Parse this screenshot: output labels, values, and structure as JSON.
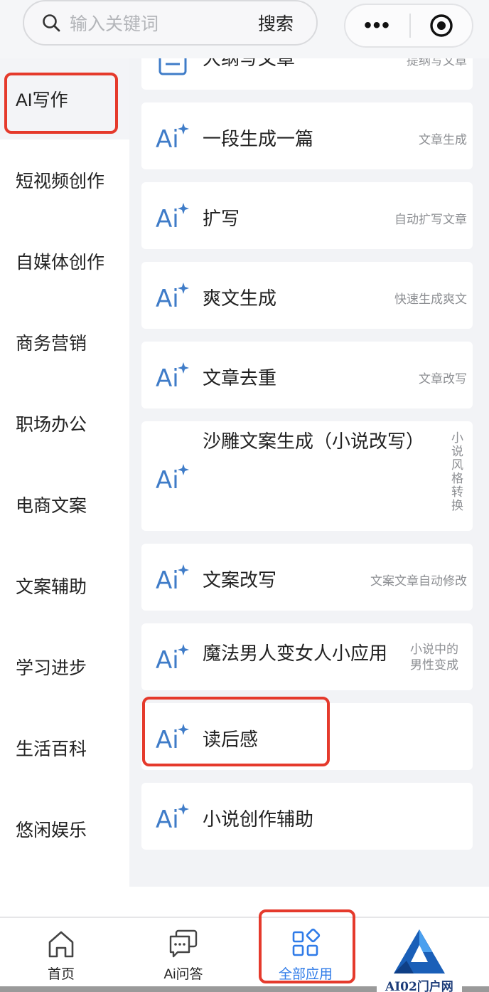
{
  "search": {
    "placeholder": "输入关键词",
    "button_label": "搜索",
    "icon": "search-icon"
  },
  "capsule": {
    "more_label": "•••",
    "more_icon": "more-dots-icon",
    "target_icon": "record-target-icon"
  },
  "sidebar": {
    "items": [
      {
        "label": "AI写作",
        "active": true
      },
      {
        "label": "短视频创作"
      },
      {
        "label": "自媒体创作"
      },
      {
        "label": "商务营销"
      },
      {
        "label": "职场办公"
      },
      {
        "label": "电商文案"
      },
      {
        "label": "文案辅助"
      },
      {
        "label": "学习进步"
      },
      {
        "label": "生活百科"
      },
      {
        "label": "悠闲娱乐"
      }
    ]
  },
  "apps": [
    {
      "title": "大纲写文章",
      "desc": "提纲写文章",
      "icon": "document-list-icon"
    },
    {
      "title": "一段生成一篇",
      "desc": "文章生成",
      "icon": "ai-sparkle-icon"
    },
    {
      "title": "扩写",
      "desc": "自动扩写文章",
      "icon": "ai-sparkle-icon"
    },
    {
      "title": "爽文生成",
      "desc": "快速生成爽文",
      "icon": "ai-sparkle-icon"
    },
    {
      "title": "文章去重",
      "desc": "文章改写",
      "icon": "ai-sparkle-icon"
    },
    {
      "title": "沙雕文案生成（小说改写）",
      "desc": "小说风格转换",
      "icon": "ai-sparkle-icon"
    },
    {
      "title": "文案改写",
      "desc": "文案文章自动修改",
      "icon": "ai-sparkle-icon"
    },
    {
      "title": "魔法男人变女人小应用",
      "desc_line1": "小说中的",
      "desc_line2": "男性变成",
      "icon": "ai-sparkle-icon"
    },
    {
      "title": "读后感",
      "desc": "",
      "icon": "ai-sparkle-icon"
    },
    {
      "title": "小说创作辅助",
      "desc": "",
      "icon": "ai-sparkle-icon"
    }
  ],
  "tabbar": {
    "items": [
      {
        "label": "首页",
        "icon": "home-icon"
      },
      {
        "label": "Ai问答",
        "icon": "chat-bubble-icon"
      },
      {
        "label": "全部应用",
        "icon": "apps-grid-icon",
        "active": true
      },
      {
        "label": "",
        "icon": "profile-icon"
      }
    ]
  },
  "watermark": {
    "text": "AI02门户网"
  },
  "colors": {
    "accent": "#2f7be8",
    "highlight_border": "#e53a2c",
    "ai_icon": "#3f7cc8"
  }
}
